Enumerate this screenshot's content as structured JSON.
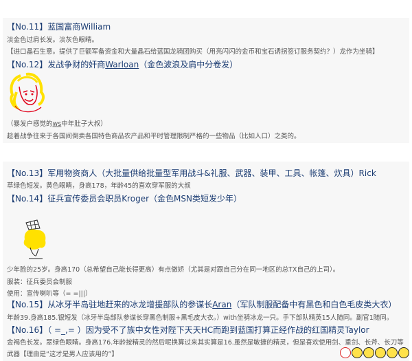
{
  "entries": {
    "e11_title": "【No.11】蓝国富商William",
    "e11_desc1": "淡金色过肩长发。淡灰色眼睛。",
    "e11_desc2": "【进口晶石生意。提供了巨额军备资金和大量晶石给蓝国龙骑团购买（用亮闪闪的金币和宝石诱拐签订服务契约？）龙作为坐骑】",
    "e12_title_a": "【No.12】发战争财的奸商",
    "e12_title_name": "Warloan",
    "e12_title_b": "（金色波浪及肩中分卷发）",
    "e12_caption_a": "（暴发户感觉的",
    "e12_caption_ws": "ws",
    "e12_caption_b": "中年肚子大叔）",
    "e12_desc": "趁着战争往来于各国间倒卖各国特色商品农产品和平时管理限制严格的一些物品（比如人口）之类的。",
    "e13_title": "【No.13】军用物资商人（大批量供给批量型军用战斗&礼服、武器、装甲、工具、帐篷、炊具）Rick",
    "e13_desc": "草绿色短发。黄色眼睛，身高178，年龄45的喜欢穿军服的大叔",
    "e14_title": "【No.14】征兵宣传委员会职员Kroger（金色MSN类短发少年）",
    "e14_desc1": "少年脸的25岁。身高170（总希望自己能长得更高）有点傲娇（尤其是对跟自己分在同一地区的总TX自己的上司）。",
    "e14_desc2": "服装：征兵委员会制服",
    "e14_desc3": "使用：宣传喇叭等（= =|||）",
    "e15_title_a": "【No.15】从冰牙半岛驻地赶来的冰龙增援部队的参谋长",
    "e15_title_name": "Aran",
    "e15_title_b": "（军队制服配备中有黑色和白色毛皮类大衣）",
    "e15_desc": "年龄39.身高185.银短发（冰牙半岛部队参谋长穿黑色制服+黑毛皮大衣。）with坐骑冰龙一只。手下部队精英15人随同。副官1随同。",
    "e16_title": "【No.16】（ =_,= ）因为受不了族中女性对陛下天天HC而跑到蓝国打算正经作战的红国精灵Taylor",
    "e16_desc1": "金褐色长发。翠绿色眼睛。身高176.年龄按精灵的然后呢换算过来其实算是16.虽然是敏捷的精灵，但是喜欢使用剑、重剑、长斧、长刀等",
    "e16_desc2": "武器【理由是“这才是男人应该用的”】"
  },
  "colors": {
    "title": "#1c3d73",
    "body": "#555555",
    "card": "#f7f7f7",
    "sketch_yellow": "#ffe100",
    "sketch_red": "#e0001a"
  },
  "icons": [
    "emoji-face-red",
    "emoji-face-1",
    "emoji-face-2",
    "emoji-face-3",
    "emoji-face-4",
    "emoji-face-5"
  ]
}
